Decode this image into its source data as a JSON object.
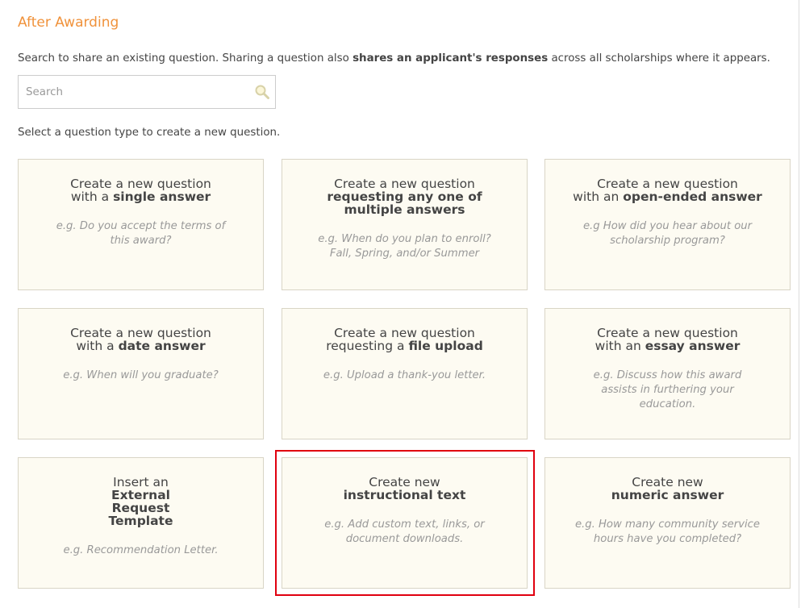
{
  "section": {
    "title": "After Awarding"
  },
  "intro": {
    "text_before": "Search to share an existing question. Sharing a question also ",
    "text_bold": "shares an applicant's responses",
    "text_after": " across all scholarships where it appears."
  },
  "search": {
    "value": "",
    "placeholder": "Search",
    "icon": "magnifier-icon"
  },
  "select_prompt": "Select a question type to create a new question.",
  "cards": [
    {
      "title_line1": "Create a new question",
      "title_pre": "with a ",
      "title_bold": "single answer",
      "example": "e.g. Do you accept the terms of this award?"
    },
    {
      "title_line1": "Create a new question",
      "title_pre": "",
      "title_bold": "requesting any one of multiple answers",
      "example_line1": "e.g. When do you plan to enroll?",
      "example_line2": "Fall, Spring, and/or Summer"
    },
    {
      "title_line1": "Create a new question",
      "title_pre": "with an ",
      "title_bold": "open-ended answer",
      "example": "e.g How did you hear about our scholarship program?"
    },
    {
      "title_line1": "Create a new question",
      "title_pre": "with a ",
      "title_bold": "date answer",
      "example": "e.g. When will you graduate?"
    },
    {
      "title_line1": "Create a new question",
      "title_pre": "requesting a ",
      "title_bold": "file upload",
      "example": "e.g. Upload a thank-you letter."
    },
    {
      "title_line1": "Create a new question",
      "title_pre": "with an ",
      "title_bold": "essay answer",
      "example": "e.g. Discuss how this award assists in furthering your education."
    },
    {
      "title_line1": "Insert an",
      "title_pre": "",
      "title_bold": "External Request Template",
      "example": "e.g. Recommendation Letter."
    },
    {
      "title_line1": "Create new",
      "title_pre": "",
      "title_bold": "instructional text",
      "example": "e.g. Add custom text, links, or document downloads."
    },
    {
      "title_line1": "Create new",
      "title_pre": "",
      "title_bold": "numeric answer",
      "example": "e.g. How many community service hours have you completed?"
    }
  ],
  "colors": {
    "section_title": "#f0923b",
    "card_background": "#fdfbf2",
    "card_border": "#d9d5c6",
    "highlight": "#e0000f"
  }
}
